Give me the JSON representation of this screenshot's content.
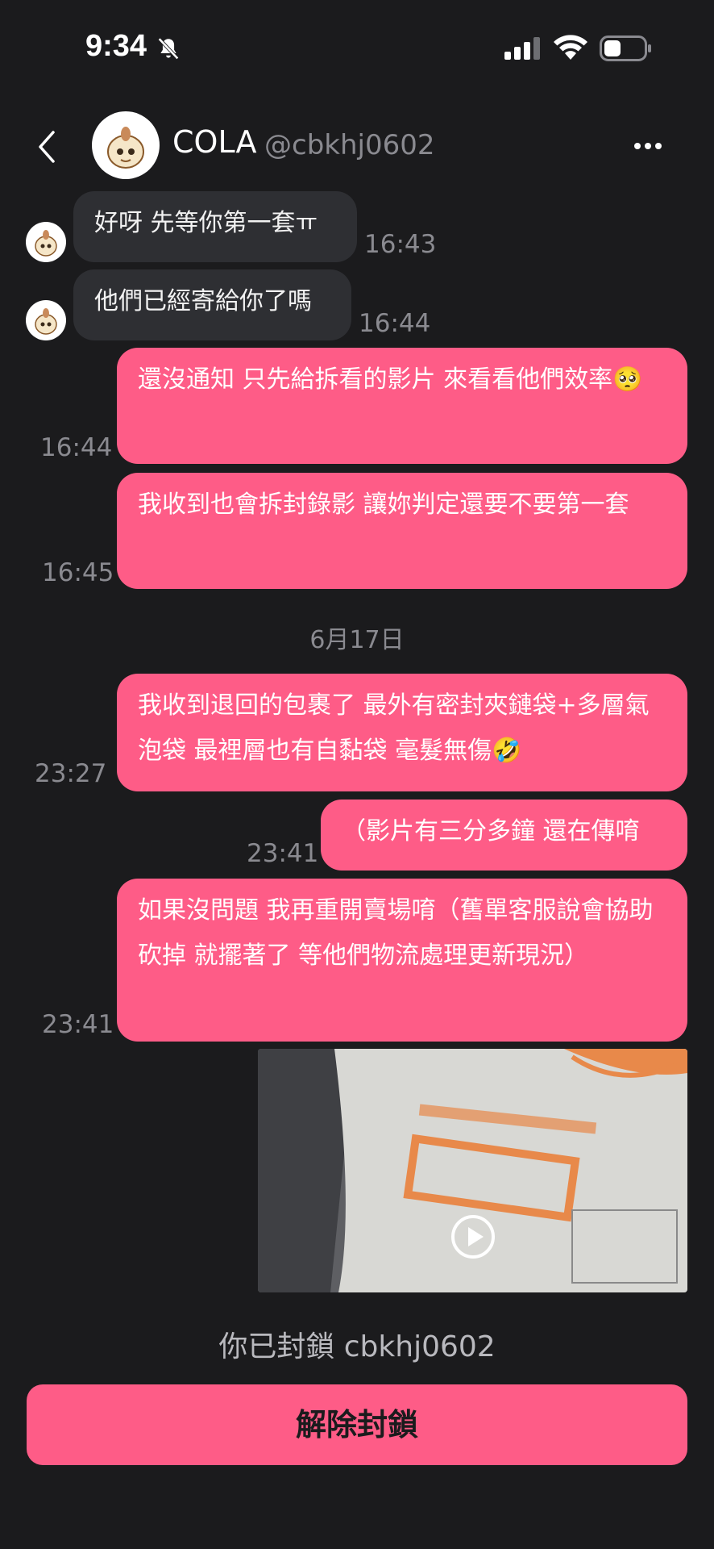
{
  "status_bar": {
    "time": "9:34",
    "icons": [
      "bell-slash-icon",
      "signal-icon",
      "wifi-icon",
      "battery-icon"
    ]
  },
  "header": {
    "back_icon": "chevron-left-icon",
    "name": "COLA",
    "handle": "@cbkhj0602",
    "more_icon": "ellipsis-icon"
  },
  "messages": [
    {
      "direction": "in",
      "text": "好呀 先等你第一套ㅠ",
      "time": "16:43"
    },
    {
      "direction": "in",
      "text": "他們已經寄給你了嗎",
      "time": "16:44"
    },
    {
      "direction": "out",
      "text": "還沒通知 只先給拆看的影片 來看看他們效率🥺",
      "time": "16:44"
    },
    {
      "direction": "out",
      "text": "我收到也會拆封錄影 讓妳判定還要不要第一套",
      "time": "16:45"
    },
    {
      "direction": "out",
      "text": "我收到退回的包裹了 最外有密封夾鏈袋+多層氣泡袋 最裡層也有自黏袋 毫髮無傷🤣",
      "time": "23:27"
    },
    {
      "direction": "out",
      "text": "（影片有三分多鐘 還在傳唷",
      "time": "23:41"
    },
    {
      "direction": "out",
      "text": "如果沒問題 我再重開賣場唷（舊單客服說會協助砍掉 就擺著了 等他們物流處理更新現況）",
      "time": "23:41"
    }
  ],
  "date_separator": "6月17日",
  "video": {
    "play_icon": "play-circle-icon"
  },
  "blocked_text": "你已封鎖 cbkhj0602",
  "unblock_button": "解除封鎖",
  "colors": {
    "background": "#1b1b1d",
    "incoming_bubble": "#2e2f33",
    "outgoing_bubble": "#fe5c87",
    "timestamp": "#8a8a90"
  }
}
